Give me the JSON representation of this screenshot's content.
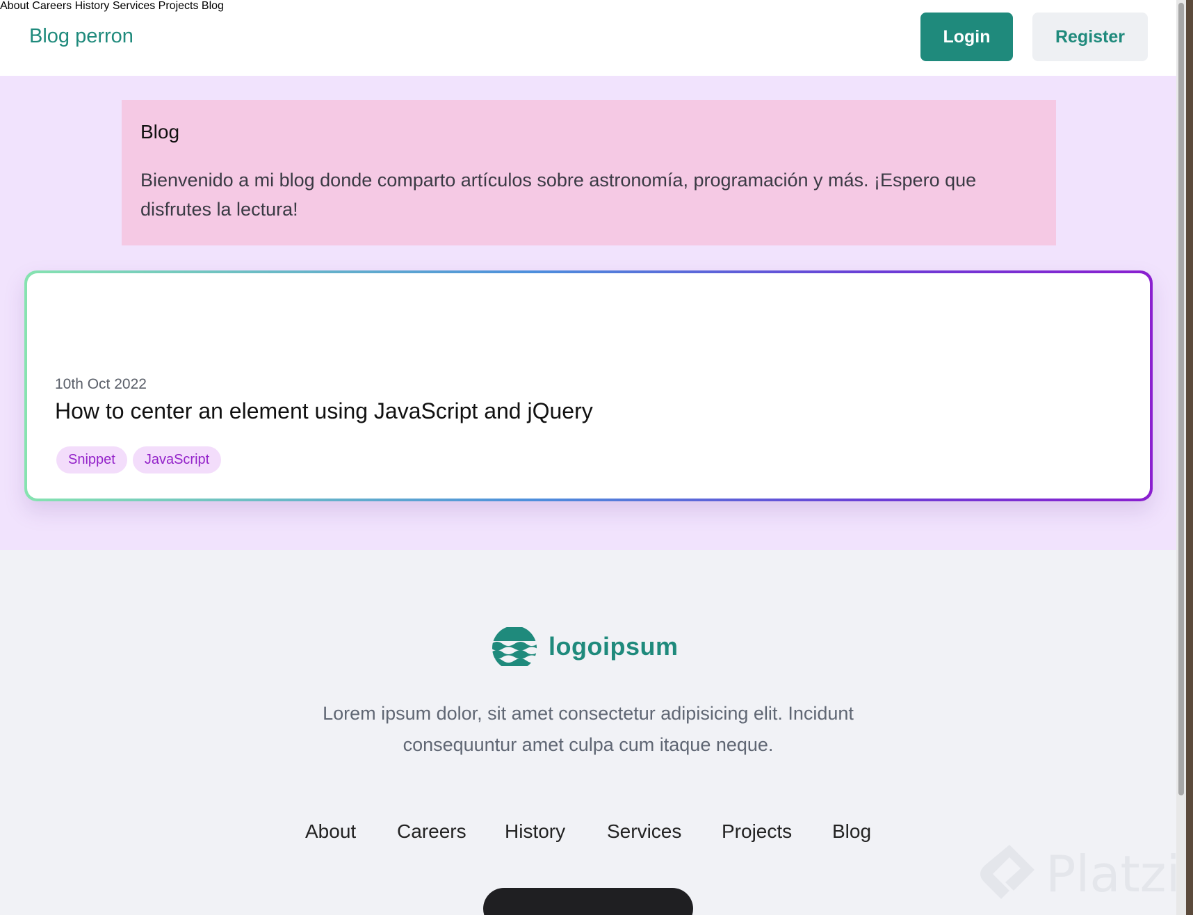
{
  "header": {
    "brand": "Blog perron",
    "nav": [
      "About",
      "Careers",
      "History",
      "Services",
      "Projects",
      "Blog"
    ],
    "login_label": "Login",
    "register_label": "Register"
  },
  "intro": {
    "title": "Blog",
    "text": "Bienvenido a mi blog donde comparto artículos sobre astronomía, programación y más. ¡Espero que disfrutes la lectura!"
  },
  "post": {
    "date": "10th Oct 2022",
    "title": "How to center an element using JavaScript and jQuery",
    "tags": [
      "Snippet",
      "JavaScript"
    ]
  },
  "footer": {
    "logo_text": "logoipsum",
    "description": "Lorem ipsum dolor, sit amet consectetur adipisicing elit. Incidunt consequuntur amet culpa cum itaque neque.",
    "nav": [
      "About",
      "Careers",
      "History",
      "Services",
      "Projects",
      "Blog"
    ]
  },
  "watermark": "Platzi",
  "colors": {
    "brand": "#1f8a7c",
    "intro_bg": "#f5c9e4",
    "main_bg": "#f1e3fd",
    "tag_text": "#9322c9"
  }
}
